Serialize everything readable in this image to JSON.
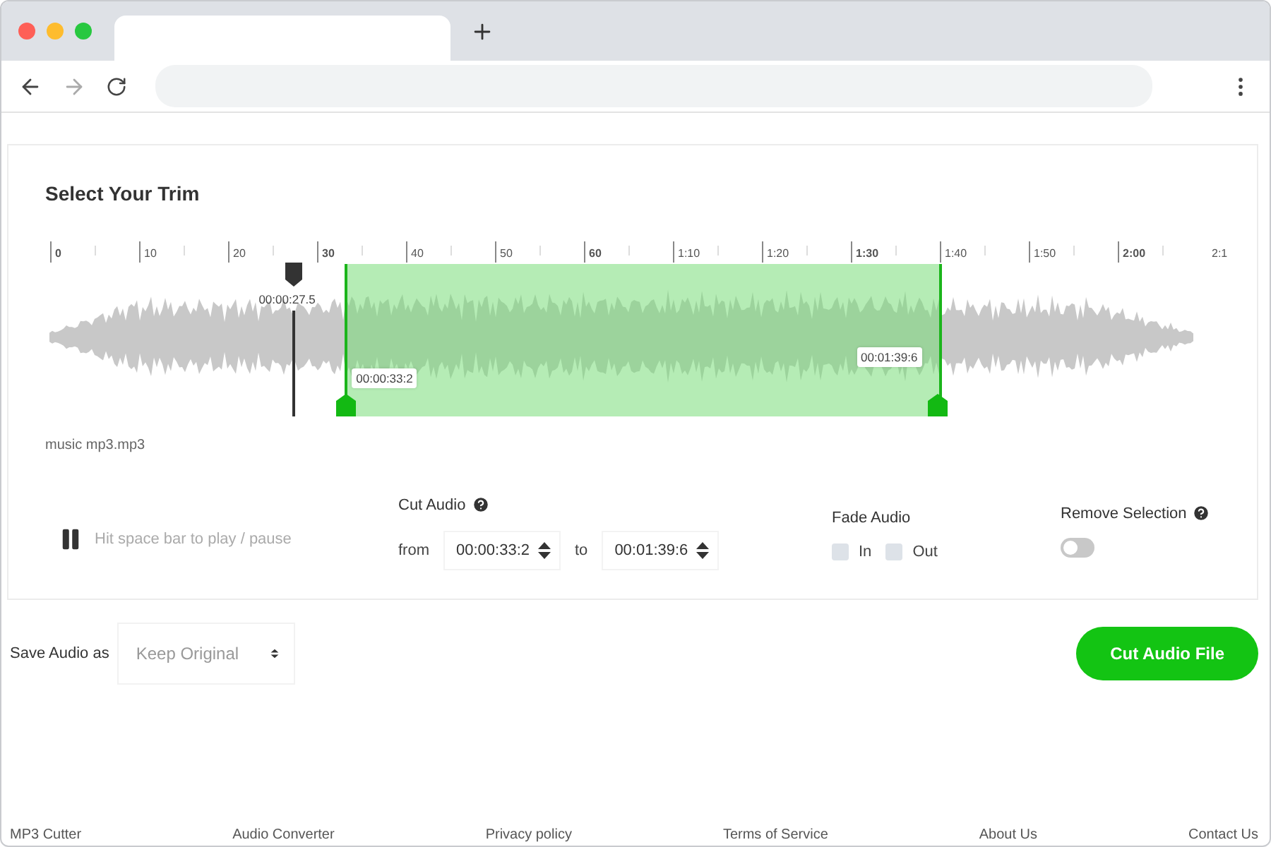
{
  "trim": {
    "title": "Select Your Trim",
    "ruler": [
      "0",
      "10",
      "20",
      "30",
      "40",
      "50",
      "60",
      "1:10",
      "1:20",
      "1:30",
      "1:40",
      "1:50",
      "2:00",
      "2:1"
    ],
    "playhead": {
      "label": "00:00:27.5",
      "level": 0.2115
    },
    "handles": [
      {
        "label": "00:00:33:2",
        "level": 0.2554
      },
      {
        "label": "00:01:39:6",
        "level": 0.7662
      }
    ],
    "file_name": "music mp3.mp3"
  },
  "controls": {
    "play_hint": "Hit space bar to play / pause",
    "playing": true,
    "cut_label": "Cut Audio",
    "from_label": "from",
    "from_value": "00:00:33:2",
    "to_label": "to",
    "to_value": "00:01:39:6",
    "fade_label": "Fade Audio",
    "fade_options": [
      {
        "label": "In",
        "checked": false
      },
      {
        "label": "Out",
        "checked": false
      }
    ],
    "remove_label": "Remove Selection",
    "remove_on": false
  },
  "save": {
    "label": "Save Audio as",
    "format": "Keep Original",
    "button": "Cut Audio File"
  },
  "footer": [
    "MP3 Cutter",
    "Audio Converter",
    "Privacy policy",
    "Terms of Service",
    "About Us",
    "Contact Us"
  ]
}
